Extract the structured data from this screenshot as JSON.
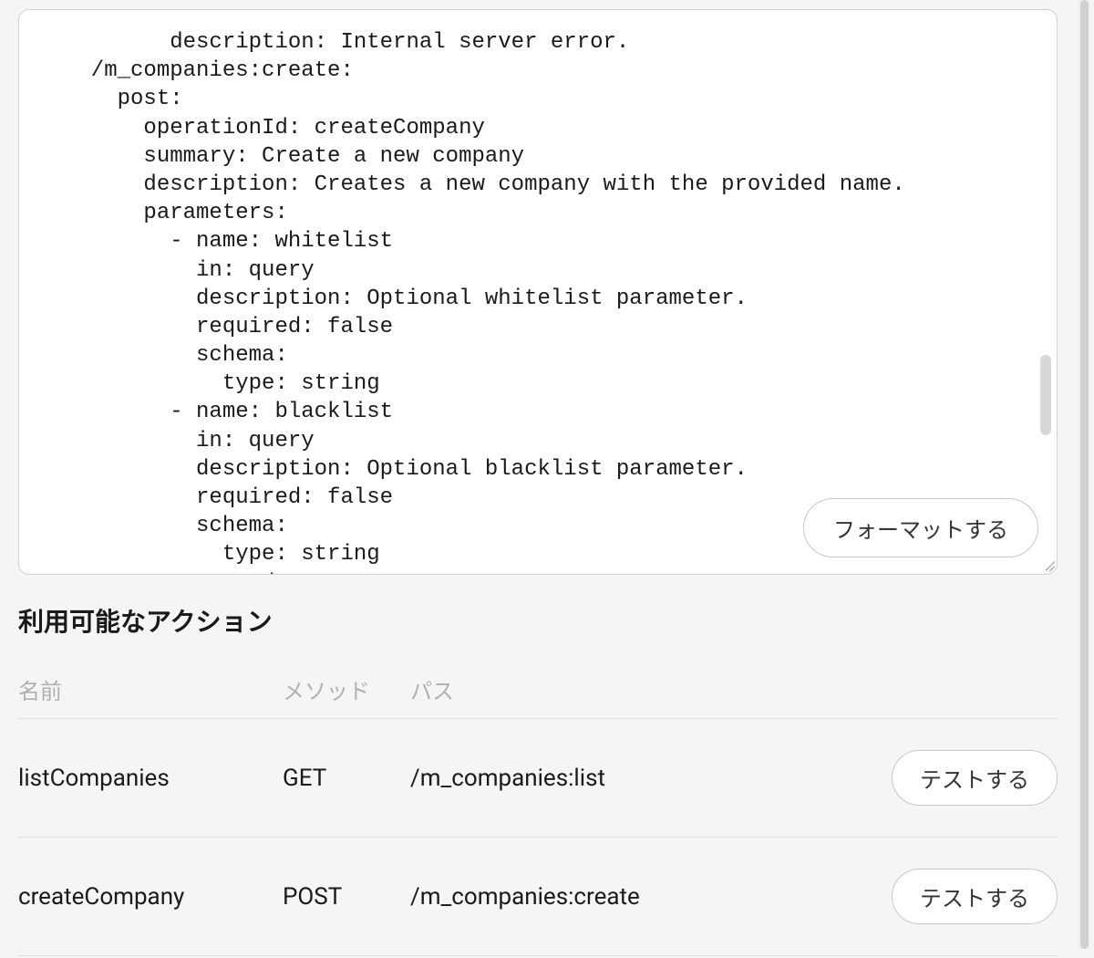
{
  "editor": {
    "content": "        description: Internal server error.\n  /m_companies:create:\n    post:\n      operationId: createCompany\n      summary: Create a new company\n      description: Creates a new company with the provided name.\n      parameters:\n        - name: whitelist\n          in: query\n          description: Optional whitelist parameter.\n          required: false\n          schema:\n            type: string\n        - name: blacklist\n          in: query\n          description: Optional blacklist parameter.\n          required: false\n          schema:\n            type: string\n      requestBody:",
    "format_button_label": "フォーマットする"
  },
  "actions": {
    "title": "利用可能なアクション",
    "columns": {
      "name": "名前",
      "method": "メソッド",
      "path": "パス"
    },
    "rows": [
      {
        "name": "listCompanies",
        "method": "GET",
        "path": "/m_companies:list",
        "button_label": "テストする"
      },
      {
        "name": "createCompany",
        "method": "POST",
        "path": "/m_companies:create",
        "button_label": "テストする"
      }
    ]
  }
}
